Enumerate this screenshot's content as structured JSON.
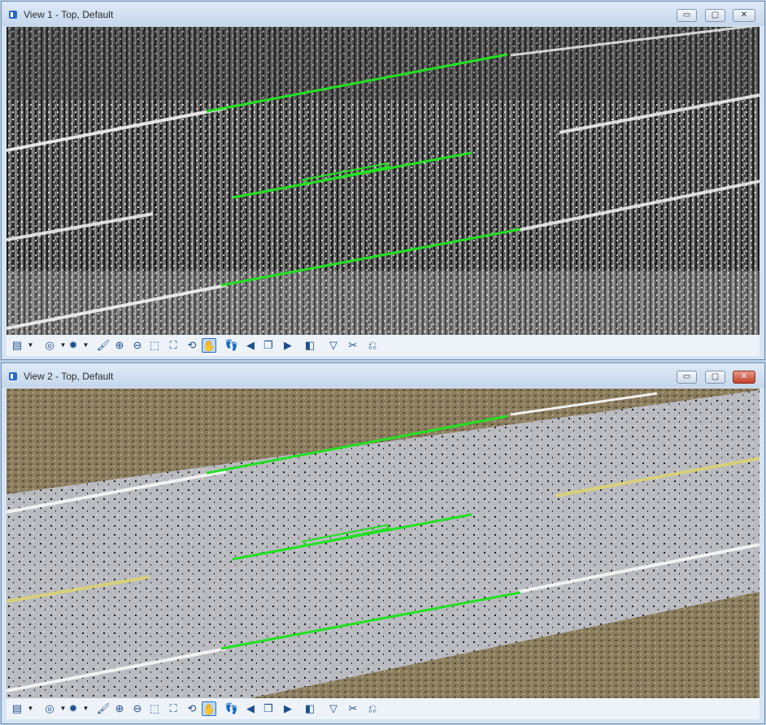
{
  "windows": [
    {
      "title": "View 1 - Top, Default",
      "mode": "intensity-grayscale"
    },
    {
      "title": "View 2 - Top, Default",
      "mode": "rgb-color"
    }
  ],
  "window_buttons": {
    "minimize": "▭",
    "maximize": "▢",
    "close": "✕"
  },
  "toolbar_icons": [
    {
      "name": "view-attributes-icon",
      "glyph": "▤"
    },
    {
      "name": "dropdown-arrow-icon",
      "glyph": "▼"
    },
    {
      "name": "view-display-mode-icon",
      "glyph": "◎"
    },
    {
      "name": "dropdown-arrow-icon",
      "glyph": "▼"
    },
    {
      "name": "lighting-icon",
      "glyph": "✹"
    },
    {
      "name": "dropdown-arrow-icon",
      "glyph": "▼"
    },
    {
      "name": "brush-icon",
      "glyph": "🖌"
    },
    {
      "name": "zoom-in-icon",
      "glyph": "⊕"
    },
    {
      "name": "zoom-out-icon",
      "glyph": "⊖"
    },
    {
      "name": "window-area-icon",
      "glyph": "⬚"
    },
    {
      "name": "fit-view-icon",
      "glyph": "⛶"
    },
    {
      "name": "rotate-view-icon",
      "glyph": "⟲"
    },
    {
      "name": "pan-view-icon",
      "glyph": "✋"
    },
    {
      "name": "walk-icon",
      "glyph": "👣"
    },
    {
      "name": "view-previous-icon",
      "glyph": "◀"
    },
    {
      "name": "copy-view-icon",
      "glyph": "❐"
    },
    {
      "name": "view-next-icon",
      "glyph": "▶"
    },
    {
      "name": "clip-volume-icon",
      "glyph": "◧"
    },
    {
      "name": "clip-mask-icon",
      "glyph": "▽"
    },
    {
      "name": "clear-clip-icon",
      "glyph": "✂"
    },
    {
      "name": "view-undo-icon",
      "glyph": "⎌"
    }
  ],
  "colors": {
    "overlay_line": "#22e022",
    "window_border": "#6f8fb3",
    "selected_tool": "#bcd8f5"
  }
}
